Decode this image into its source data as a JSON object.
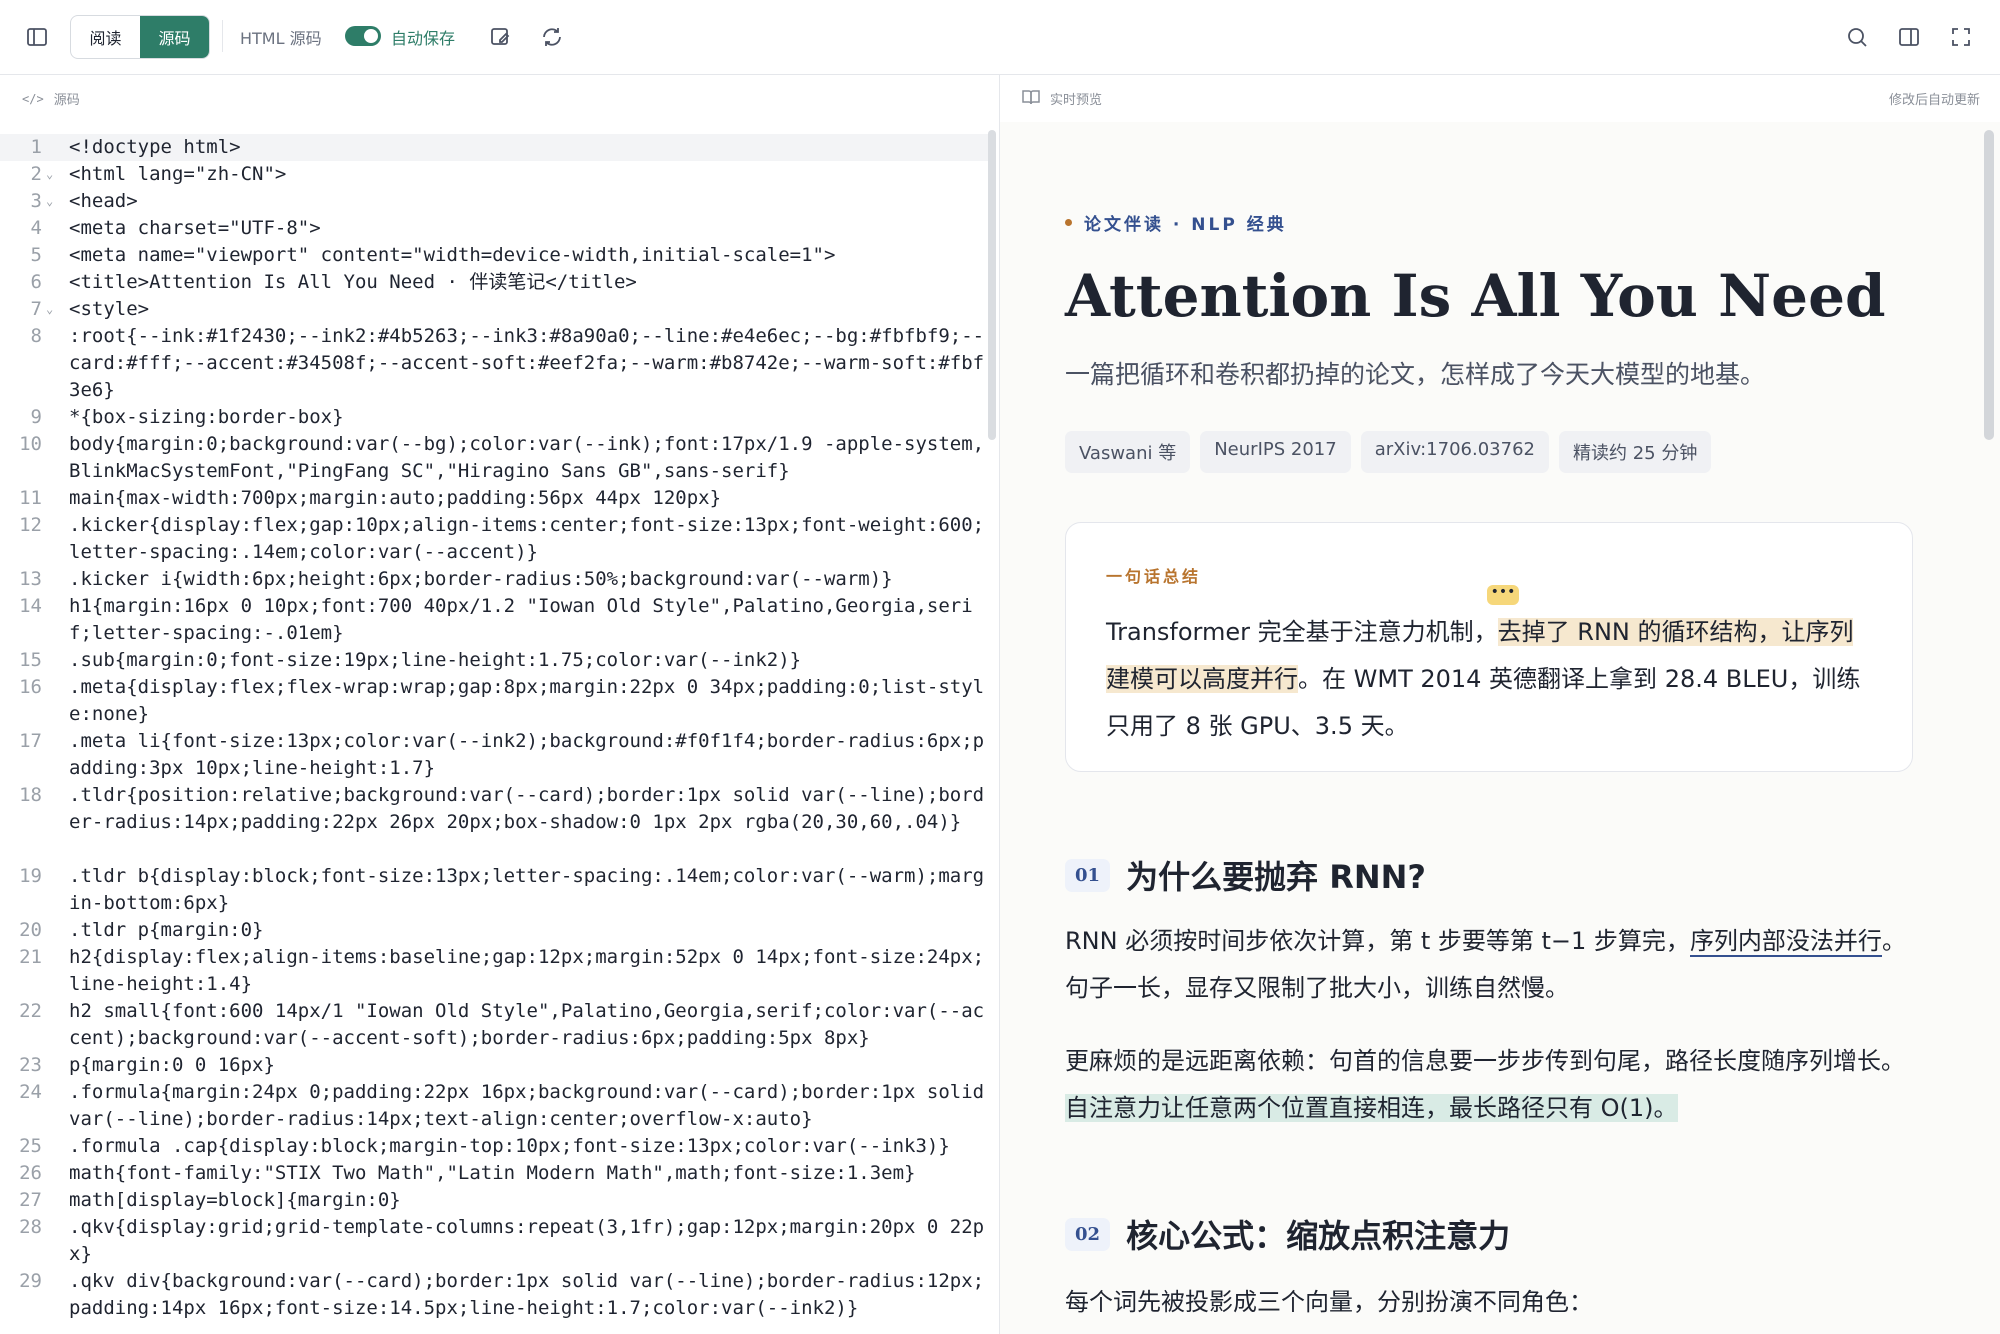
{
  "toolbar": {
    "read_label": "阅读",
    "source_label": "源码",
    "html_source_label": "HTML 源码",
    "autosave_label": "自动保存",
    "autosave_on": true
  },
  "left_pane": {
    "title": "源码"
  },
  "right_pane": {
    "title": "实时预览",
    "hint": "修改后自动更新"
  },
  "code_lines": [
    {
      "n": "1",
      "fold": "",
      "text": "<!doctype html>"
    },
    {
      "n": "2",
      "fold": "⌄",
      "text": "<html lang=\"zh-CN\">"
    },
    {
      "n": "3",
      "fold": "⌄",
      "text": "<head>"
    },
    {
      "n": "4",
      "fold": "",
      "text": "<meta charset=\"UTF-8\">"
    },
    {
      "n": "5",
      "fold": "",
      "text": "<meta name=\"viewport\" content=\"width=device-width,initial-scale=1\">"
    },
    {
      "n": "6",
      "fold": "",
      "text": "<title>Attention Is All You Need · 伴读笔记</title>"
    },
    {
      "n": "7",
      "fold": "⌄",
      "text": "<style>"
    },
    {
      "n": "8",
      "fold": "",
      "text": ":root{--ink:#1f2430;--ink2:#4b5263;--ink3:#8a90a0;--line:#e4e6ec;--bg:#fbfbf9;--card:#fff;--accent:#34508f;--accent-soft:#eef2fa;--warm:#b8742e;--warm-soft:#fbf3e6}"
    },
    {
      "n": "9",
      "fold": "",
      "text": "*{box-sizing:border-box}"
    },
    {
      "n": "10",
      "fold": "",
      "text": "body{margin:0;background:var(--bg);color:var(--ink);font:17px/1.9 -apple-system,BlinkMacSystemFont,\"PingFang SC\",\"Hiragino Sans GB\",sans-serif}"
    },
    {
      "n": "11",
      "fold": "",
      "text": "main{max-width:700px;margin:auto;padding:56px 44px 120px}"
    },
    {
      "n": "12",
      "fold": "",
      "text": ".kicker{display:flex;gap:10px;align-items:center;font-size:13px;font-weight:600;letter-spacing:.14em;color:var(--accent)}"
    },
    {
      "n": "13",
      "fold": "",
      "text": ".kicker i{width:6px;height:6px;border-radius:50%;background:var(--warm)}"
    },
    {
      "n": "14",
      "fold": "",
      "text": "h1{margin:16px 0 10px;font:700 40px/1.2 \"Iowan Old Style\",Palatino,Georgia,serif;letter-spacing:-.01em}"
    },
    {
      "n": "15",
      "fold": "",
      "text": ".sub{margin:0;font-size:19px;line-height:1.75;color:var(--ink2)}"
    },
    {
      "n": "16",
      "fold": "",
      "text": ".meta{display:flex;flex-wrap:wrap;gap:8px;margin:22px 0 34px;padding:0;list-style:none}"
    },
    {
      "n": "17",
      "fold": "",
      "text": ".meta li{font-size:13px;color:var(--ink2);background:#f0f1f4;border-radius:6px;padding:3px 10px;line-height:1.7}"
    },
    {
      "n": "18",
      "fold": "",
      "text": ".tldr{position:relative;background:var(--card);border:1px solid var(--line);border-radius:14px;padding:22px 26px 20px;box-shadow:0 1px 2px rgba(20,30,60,.04)}"
    },
    {
      "n": "19",
      "fold": "",
      "text": ".tldr b{display:block;font-size:13px;letter-spacing:.14em;color:var(--warm);margin-bottom:6px}"
    },
    {
      "n": "20",
      "fold": "",
      "text": ".tldr p{margin:0}"
    },
    {
      "n": "21",
      "fold": "",
      "text": "h2{display:flex;align-items:baseline;gap:12px;margin:52px 0 14px;font-size:24px;line-height:1.4}"
    },
    {
      "n": "22",
      "fold": "",
      "text": "h2 small{font:600 14px/1 \"Iowan Old Style\",Palatino,Georgia,serif;color:var(--accent);background:var(--accent-soft);border-radius:6px;padding:5px 8px}"
    },
    {
      "n": "23",
      "fold": "",
      "text": "p{margin:0 0 16px}"
    },
    {
      "n": "24",
      "fold": "",
      "text": ".formula{margin:24px 0;padding:22px 16px;background:var(--card);border:1px solid var(--line);border-radius:14px;text-align:center;overflow-x:auto}"
    },
    {
      "n": "25",
      "fold": "",
      "text": ".formula .cap{display:block;margin-top:10px;font-size:13px;color:var(--ink3)}"
    },
    {
      "n": "26",
      "fold": "",
      "text": "math{font-family:\"STIX Two Math\",\"Latin Modern Math\",math;font-size:1.3em}"
    },
    {
      "n": "27",
      "fold": "",
      "text": "math[display=block]{margin:0}"
    },
    {
      "n": "28",
      "fold": "",
      "text": ".qkv{display:grid;grid-template-columns:repeat(3,1fr);gap:12px;margin:20px 0 22px}"
    },
    {
      "n": "29",
      "fold": "",
      "text": ".qkv div{background:var(--card);border:1px solid var(--line);border-radius:12px;padding:14px 16px;font-size:14.5px;line-height:1.7;color:var(--ink2)}"
    }
  ],
  "preview": {
    "kicker": "论文伴读 · NLP 经典",
    "title": "Attention Is All You Need",
    "subtitle": "一篇把循环和卷积都扔掉的论文，怎样成了今天大模型的地基。",
    "meta": [
      "Vaswani 等",
      "NeurIPS 2017",
      "arXiv:1706.03762",
      "精读约 25 分钟"
    ],
    "tldr": {
      "label": "一句话总结",
      "more": "•••",
      "t1": "Transformer 完全基于注意力机制，",
      "t2": "去掉了 RNN 的循环结构，让序列建模可以高度并行",
      "t3": "。在 WMT 2014 英德翻译上拿到 28.4 BLEU，训练只用了 8 张 GPU、3.5 天。"
    },
    "section1": {
      "num": "01",
      "title": "为什么要抛弃 RNN?",
      "p1a": "RNN 必须按时间步依次计算，第 t 步要等第 t−1 步算完，",
      "p1b": "序列内部没法并行",
      "p1c": "。句子一长，显存又限制了批大小，训练自然慢。",
      "p2a": "更麻烦的是远距离依赖：句首的信息要一步步传到句尾，路径长度随序列增长。",
      "p2b": "自注意力让任意两个位置直接相连，最长路径只有 O(1)。"
    },
    "section2": {
      "num": "02",
      "title": "核心公式：缩放点积注意力",
      "p1": "每个词先被投影成三个向量，分别扮演不同角色："
    }
  },
  "colors": {
    "accent": "#2e7d68",
    "link": "#34508f",
    "warm": "#b8742e"
  }
}
